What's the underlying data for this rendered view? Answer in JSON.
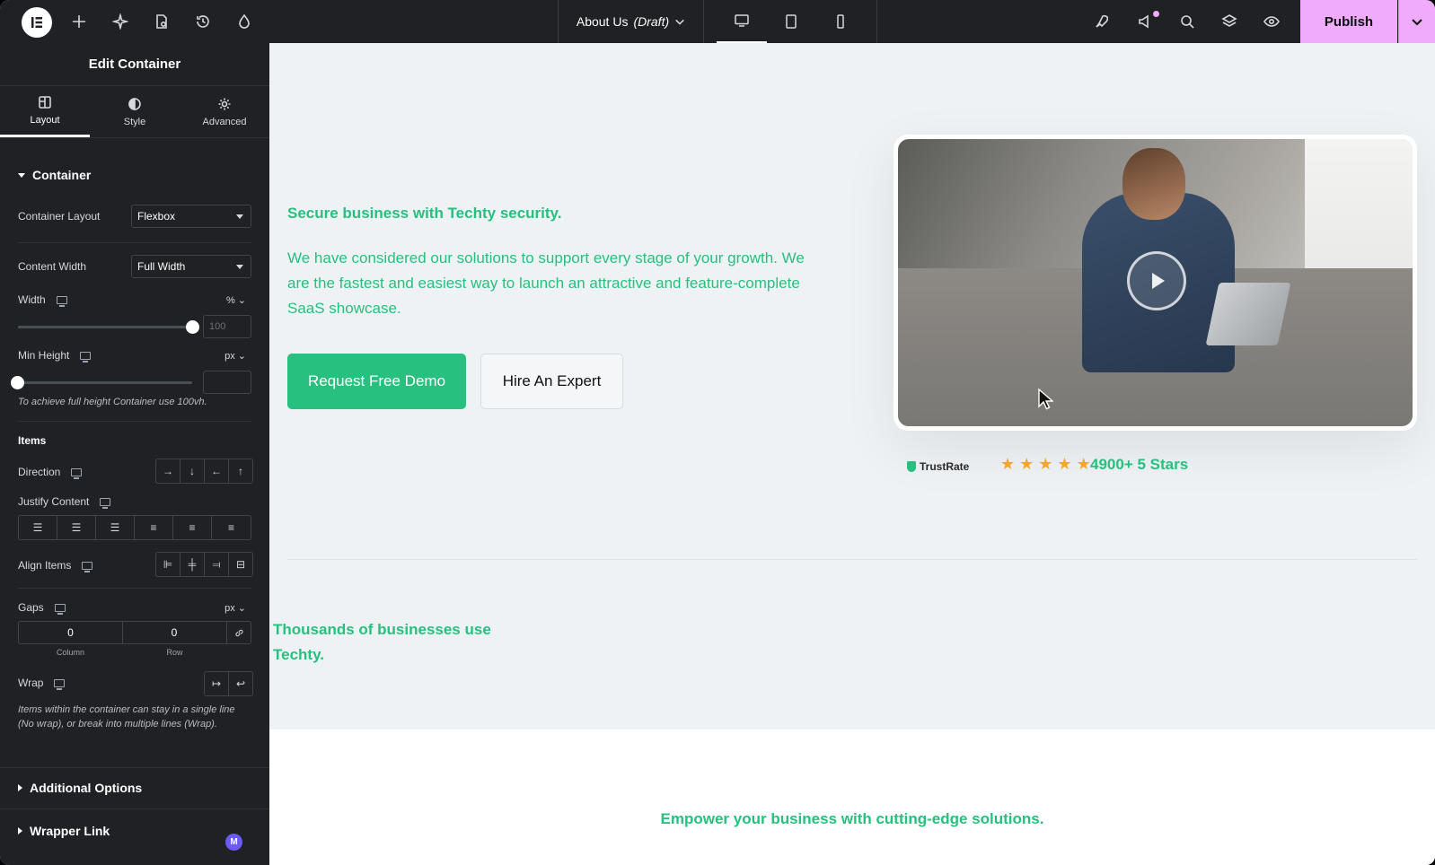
{
  "topbar": {
    "doc_title": "About Us",
    "doc_status": "(Draft)",
    "publish_label": "Publish"
  },
  "panel": {
    "title": "Edit Container",
    "tabs": [
      {
        "label": "Layout"
      },
      {
        "label": "Style"
      },
      {
        "label": "Advanced"
      }
    ],
    "section_container": "Container",
    "container_layout_label": "Container Layout",
    "container_layout_value": "Flexbox",
    "content_width_label": "Content Width",
    "content_width_value": "Full Width",
    "width_label": "Width",
    "width_unit": "%",
    "width_placeholder": "100",
    "width_value_fraction": 1.0,
    "min_height_label": "Min Height",
    "min_height_unit": "px",
    "min_height_hint": "To achieve full height Container use 100vh.",
    "items_header": "Items",
    "direction_label": "Direction",
    "justify_label": "Justify Content",
    "align_label": "Align Items",
    "gaps_label": "Gaps",
    "gaps_unit": "px",
    "gap_column_value": "0",
    "gap_row_value": "0",
    "gap_column_label": "Column",
    "gap_row_label": "Row",
    "wrap_label": "Wrap",
    "wrap_hint": "Items within the container can stay in a single line (No wrap), or break into multiple lines (Wrap).",
    "additional_options": "Additional Options",
    "wrapper_link": "Wrapper Link",
    "badge": "M"
  },
  "canvas": {
    "eyebrow": "Secure business with Techty security.",
    "description": "We have considered our solutions to support every stage of your growth. We are the fastest and easiest way to launch an attractive and feature-complete SaaS showcase.",
    "btn_demo": "Request Free Demo",
    "btn_expert": "Hire An Expert",
    "trust_brand": "TrustRate",
    "stars_text": "4900+ 5 Stars",
    "rating_stars": 5,
    "thousands": "Thousands of businesses use Techty.",
    "empower": "Empower your business with cutting-edge solutions."
  },
  "colors": {
    "accent_green": "#27c07e",
    "publish_pink": "#f0abfc",
    "panel_bg": "#1f2124",
    "canvas_bg": "#eef2f5"
  }
}
